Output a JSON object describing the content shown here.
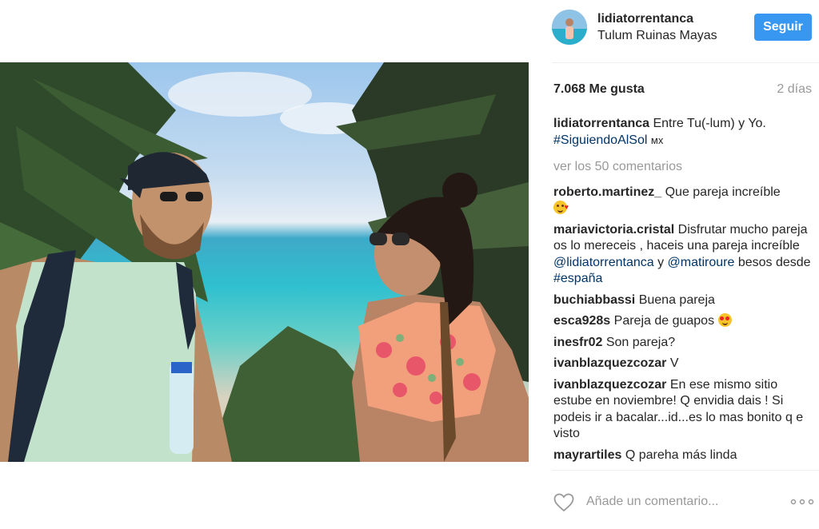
{
  "post": {
    "username": "lidiatorrentanca",
    "location": "Tulum Ruinas Mayas",
    "follow_label": "Seguir",
    "likes": "7.068 Me gusta",
    "age": "2 días",
    "caption": {
      "author": "lidiatorrentanca",
      "text": "Entre Tu(-lum) y Yo.",
      "hashtag": "#SiguiendoAlSol",
      "suffix": "мх"
    },
    "view_all": "ver los 50 comentarios",
    "comments": [
      {
        "author": "roberto.martinez_",
        "text": "Que pareja increíble",
        "emoji": "kissing-face"
      },
      {
        "author": "mariavictoria.cristal",
        "text": "Disfrutar mucho pareja os lo mereceis , haceis una pareja increíble",
        "mention1": "@lidiatorrentanca",
        "middle": "y",
        "mention2": "@matiroure",
        "tail": "besos desde",
        "hashtag": "#españa"
      },
      {
        "author": "buchiabbassi",
        "text": "Buena pareja"
      },
      {
        "author": "esca928s",
        "text": "Pareja de guapos",
        "emoji": "heart-eyes-face"
      },
      {
        "author": "inesfr02",
        "text": "Son pareja?"
      },
      {
        "author": "ivanblazquezcozar",
        "text": "V"
      },
      {
        "author": "ivanblazquezcozar",
        "text": "En ese mismo sitio estube en noviembre! Q envidia dais ! Si podeis ir a bacalar...id...es lo mas bonito q e visto"
      },
      {
        "author": "mayrartiles",
        "text": "Q pareha más linda"
      }
    ],
    "comment_placeholder": "Añade un comentario...",
    "icons": {
      "like": "heart-outline-icon",
      "options": "more-options-icon"
    },
    "colors": {
      "accent": "#3897f0",
      "link": "#003569",
      "muted": "#999999"
    }
  }
}
